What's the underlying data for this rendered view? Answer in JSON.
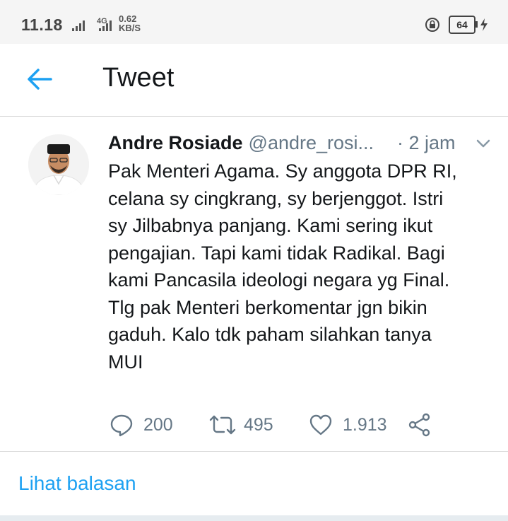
{
  "status_bar": {
    "time": "11.18",
    "network_small": "4G",
    "speed_value": "0.62",
    "speed_unit": "KB/S",
    "battery": "64"
  },
  "app_bar": {
    "title": "Tweet",
    "back_icon": "arrow-left-icon"
  },
  "tweet": {
    "author_name": "Andre Rosiade",
    "author_handle": "@andre_rosi...",
    "timestamp": "· 2 jam",
    "text": "Pak Menteri Agama. Sy anggota DPR RI,\ncelana sy cingkrang, sy berjenggot. Istri\nsy Jilbabnya panjang. Kami sering ikut\npengajian. Tapi kami tidak Radikal. Bagi\nkami Pancasila ideologi negara yg Final.\nTlg pak Menteri berkomentar jgn bikin\ngaduh. Kalo tdk paham silahkan tanya\nMUI",
    "actions": {
      "reply_count": "200",
      "retweet_count": "495",
      "like_count": "1.913"
    }
  },
  "footer": {
    "replies_link": "Lihat balasan"
  },
  "colors": {
    "accent": "#1da1f2",
    "secondary_text": "#657786",
    "primary_text": "#14171a"
  }
}
